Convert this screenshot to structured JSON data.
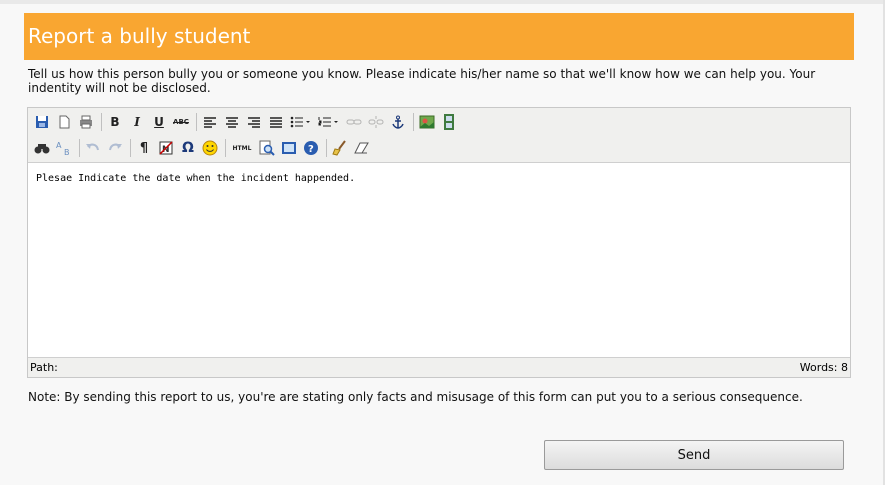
{
  "header": {
    "title": "Report a bully student"
  },
  "intro": {
    "text": "Tell us how this person bully you or someone you know. Please indicate his/her name so that we'll know how we can help you. Your indentity will not be disclosed."
  },
  "editor": {
    "toolbar_row1": [
      "save-icon",
      "new-document-icon",
      "print-icon",
      "bold",
      "italic",
      "underline",
      "strikethrough",
      "align-left",
      "align-center",
      "align-right",
      "justify",
      "bullet-list",
      "numbered-list",
      "link",
      "unlink",
      "anchor",
      "image",
      "media"
    ],
    "toolbar_row2": [
      "find-icon",
      "replace-icon",
      "undo-icon",
      "redo-icon",
      "paragraph-icon",
      "remove-format-icon",
      "special-char",
      "emoticon-icon",
      "html-source",
      "preview-icon",
      "fullscreen-icon",
      "help-icon",
      "cleanup-icon",
      "eraser-icon"
    ],
    "labels": {
      "bold": "B",
      "italic": "I",
      "underline": "U",
      "strike": "ABC",
      "omega": "Ω",
      "html": "HTML",
      "pilcrow": "¶"
    },
    "content": "Plesae Indicate the date when the incident happended.",
    "status": {
      "path_label": "Path:",
      "words_label": "Words: 8"
    }
  },
  "note": {
    "text": "Note: By sending this report to us, you're are stating only facts and misusage of this form can put you to a serious consequence."
  },
  "actions": {
    "send_label": "Send"
  },
  "colors": {
    "header_bg": "#f9a631",
    "toolbar_bg": "#f0f0ee",
    "page_bg": "#f8f8f8"
  }
}
